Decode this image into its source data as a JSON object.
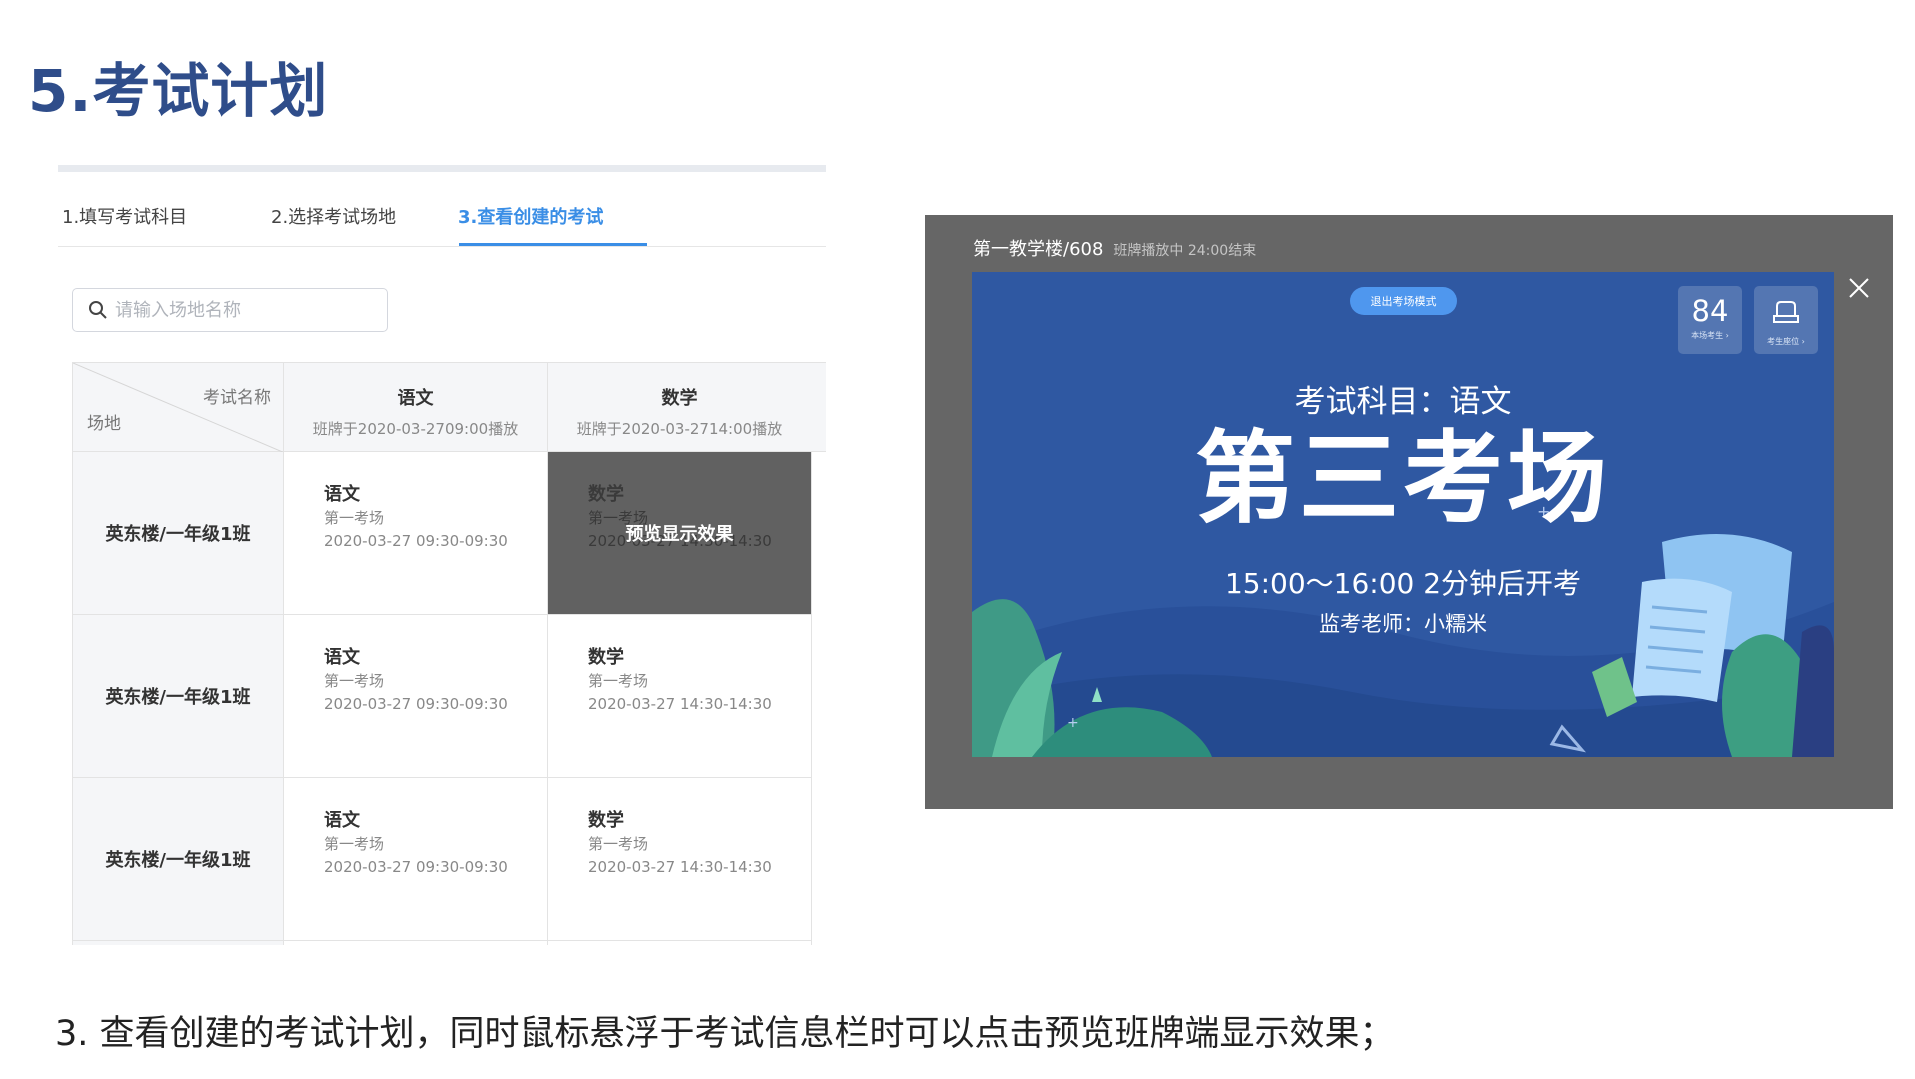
{
  "slide": {
    "title": "5.考试计划",
    "caption": "3. 查看创建的考试计划，同时鼠标悬浮于考试信息栏时可以点击预览班牌端显示效果；"
  },
  "steps": [
    {
      "label": "1.填写考试科目",
      "active": false
    },
    {
      "label": "2.选择考试场地",
      "active": false
    },
    {
      "label": "3.查看创建的考试",
      "active": true
    }
  ],
  "search": {
    "placeholder": "请输入场地名称",
    "icon": "search-icon"
  },
  "table": {
    "corner_top": "考试名称",
    "corner_bottom": "场地",
    "columns": [
      {
        "name": "语文",
        "sub": "班牌于2020-03-2709:00播放"
      },
      {
        "name": "数学",
        "sub": "班牌于2020-03-2714:00播放"
      }
    ],
    "rows": [
      {
        "venue": "英东楼/一年级1班",
        "cells": [
          {
            "subject": "语文",
            "room": "第一考场",
            "time": "2020-03-27 09:30-09:30"
          },
          {
            "subject": "数学",
            "room": "第一考场",
            "time": "2020-03-27 14:30-14:30",
            "overlay": "预览显示效果"
          }
        ]
      },
      {
        "venue": "英东楼/一年级1班",
        "cells": [
          {
            "subject": "语文",
            "room": "第一考场",
            "time": "2020-03-27 09:30-09:30"
          },
          {
            "subject": "数学",
            "room": "第一考场",
            "time": "2020-03-27 14:30-14:30"
          }
        ]
      },
      {
        "venue": "英东楼/一年级1班",
        "cells": [
          {
            "subject": "语文",
            "room": "第一考场",
            "time": "2020-03-27 09:30-09:30"
          },
          {
            "subject": "数学",
            "room": "第一考场",
            "time": "2020-03-27 14:30-14:30"
          }
        ]
      }
    ]
  },
  "preview": {
    "location": "第一教学楼/608",
    "status": "班牌播放中 24:00结束",
    "exit_label": "退出考场模式",
    "count": "84",
    "count_caption": "本场考生 ›",
    "seat_caption": "考生座位 ›",
    "subject_line": "考试科目：语文",
    "room": "第三考场",
    "time_line": "15:00～16:00 2分钟后开考",
    "teacher_line": "监考老师：小糯米"
  },
  "colors": {
    "title": "#2f4d8a",
    "accent": "#3a8ee6",
    "screen_bg": "#2f58a2",
    "modal_bg": "#666666",
    "hover_cell": "#616161"
  }
}
